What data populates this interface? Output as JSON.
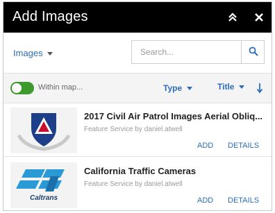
{
  "window": {
    "title": "Add Images"
  },
  "toolbar": {
    "source_label": "Images",
    "search_placeholder": "Search..."
  },
  "filters": {
    "within_map_label": "Within map...",
    "within_map_on": true,
    "type_label": "Type",
    "sort_label": "Title"
  },
  "results": [
    {
      "title": "2017 Civil Air Patrol Images Aerial Obliq...",
      "subtitle": "Feature Service by daniel.atwell",
      "add_label": "ADD",
      "details_label": "DETAILS"
    },
    {
      "title": "California Traffic Cameras",
      "subtitle": "Feature Service by daniel.atwell",
      "add_label": "ADD",
      "details_label": "DETAILS",
      "logo_text": "Caltrans"
    }
  ],
  "colors": {
    "accent": "#2b6cb8",
    "toggle_on": "#3e9a2c",
    "titlebar": "#000000"
  }
}
